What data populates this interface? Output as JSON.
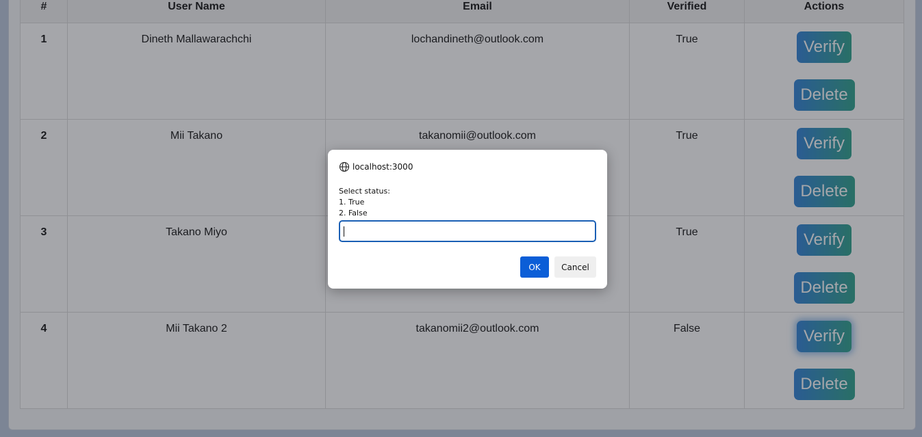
{
  "table": {
    "headers": {
      "num": "#",
      "username": "User Name",
      "email": "Email",
      "verified": "Verified",
      "actions": "Actions"
    },
    "rows": [
      {
        "num": "1",
        "username": "Dineth Mallawarachchi",
        "email": "lochandineth@outlook.com",
        "verified": "True"
      },
      {
        "num": "2",
        "username": "Mii Takano",
        "email": "takanomii@outlook.com",
        "verified": "True"
      },
      {
        "num": "3",
        "username": "Takano Miyo",
        "email": "",
        "verified": "True"
      },
      {
        "num": "4",
        "username": "Mii Takano 2",
        "email": "takanomii2@outlook.com",
        "verified": "False"
      }
    ],
    "verify_label": "Verify",
    "delete_label": "Delete"
  },
  "dialog": {
    "origin": "localhost:3000",
    "message_line1": "Select status:",
    "message_line2": "1. True",
    "message_line3": "2. False",
    "input_value": "",
    "ok_label": "OK",
    "cancel_label": "Cancel"
  },
  "colors": {
    "button_gradient_start": "#2d80d6",
    "button_gradient_end": "#2aa18a",
    "ok_button": "#0b5ed7",
    "input_focus_border": "#1a5fb4"
  },
  "icons": {
    "origin_icon": "globe-icon"
  }
}
